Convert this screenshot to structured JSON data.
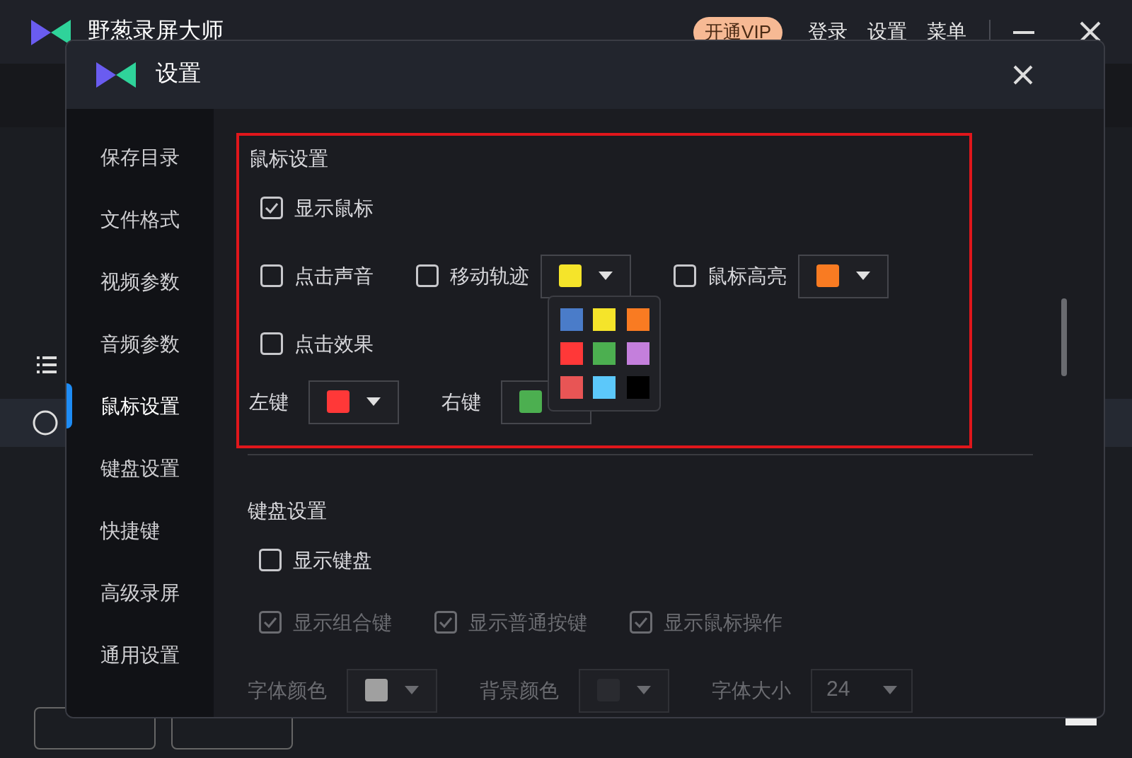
{
  "app": {
    "title": "野葱录屏大师",
    "vip_button": "开通VIP",
    "menu": [
      "登录",
      "设置",
      "菜单"
    ]
  },
  "dialog": {
    "title": "设置",
    "sidebar": [
      {
        "label": "保存目录",
        "selected": false
      },
      {
        "label": "文件格式",
        "selected": false
      },
      {
        "label": "视频参数",
        "selected": false
      },
      {
        "label": "音频参数",
        "selected": false
      },
      {
        "label": "鼠标设置",
        "selected": true
      },
      {
        "label": "键盘设置",
        "selected": false
      },
      {
        "label": "快捷键",
        "selected": false
      },
      {
        "label": "高级录屏",
        "selected": false
      },
      {
        "label": "通用设置",
        "selected": false
      }
    ],
    "mouse_settings": {
      "title": "鼠标设置",
      "groups": [
        {
          "items": [
            {
              "kind": "checkbox",
              "label": "显示鼠标",
              "checked": true
            }
          ]
        },
        {
          "items": [
            {
              "kind": "checkbox",
              "label": "点击声音",
              "checked": false
            },
            {
              "kind": "checkbox",
              "label": "移动轨迹",
              "checked": false
            },
            {
              "kind": "color",
              "color": "#f5e42a"
            },
            {
              "kind": "checkbox",
              "label": "鼠标高亮",
              "checked": false
            },
            {
              "kind": "color",
              "color": "#f97b22"
            }
          ]
        },
        {
          "items": [
            {
              "kind": "checkbox",
              "label": "点击效果",
              "checked": false
            }
          ]
        },
        {
          "items": [
            {
              "kind": "label",
              "label": "左键"
            },
            {
              "kind": "color",
              "color": "#ff3838"
            },
            {
              "kind": "label",
              "label": "右键"
            },
            {
              "kind": "color",
              "color": "#4caf50"
            }
          ]
        }
      ]
    },
    "color_palette": [
      {
        "color": "#4a7cc9"
      },
      {
        "color": "#f5e42a"
      },
      {
        "color": "#f97b22"
      },
      {
        "color": "#ff3838"
      },
      {
        "color": "#4caf50"
      },
      {
        "color": "#c47fdc"
      },
      {
        "color": "#e85555"
      },
      {
        "color": "#5cc8fa"
      },
      {
        "color": "#000000"
      }
    ],
    "keyboard_settings": {
      "title": "键盘设置",
      "groups": [
        {
          "items": [
            {
              "kind": "checkbox",
              "label": "显示键盘",
              "checked": false,
              "disabled": false
            }
          ]
        },
        {
          "items": [
            {
              "kind": "checkbox",
              "label": "显示组合键",
              "checked": true,
              "disabled": true
            },
            {
              "kind": "checkbox",
              "label": "显示普通按键",
              "checked": true,
              "disabled": true
            },
            {
              "kind": "checkbox",
              "label": "显示鼠标操作",
              "checked": true,
              "disabled": true
            }
          ]
        },
        {
          "items": [
            {
              "kind": "label",
              "label": "字体颜色",
              "disabled": true
            },
            {
              "kind": "color",
              "color": "#a0a0a0",
              "disabled": true
            },
            {
              "kind": "label",
              "label": "背景颜色",
              "disabled": true
            },
            {
              "kind": "color",
              "color": "#2a2b30",
              "disabled": true
            },
            {
              "kind": "label",
              "label": "字体大小",
              "disabled": true
            },
            {
              "kind": "select",
              "value": "24",
              "disabled": true
            }
          ]
        }
      ]
    }
  }
}
